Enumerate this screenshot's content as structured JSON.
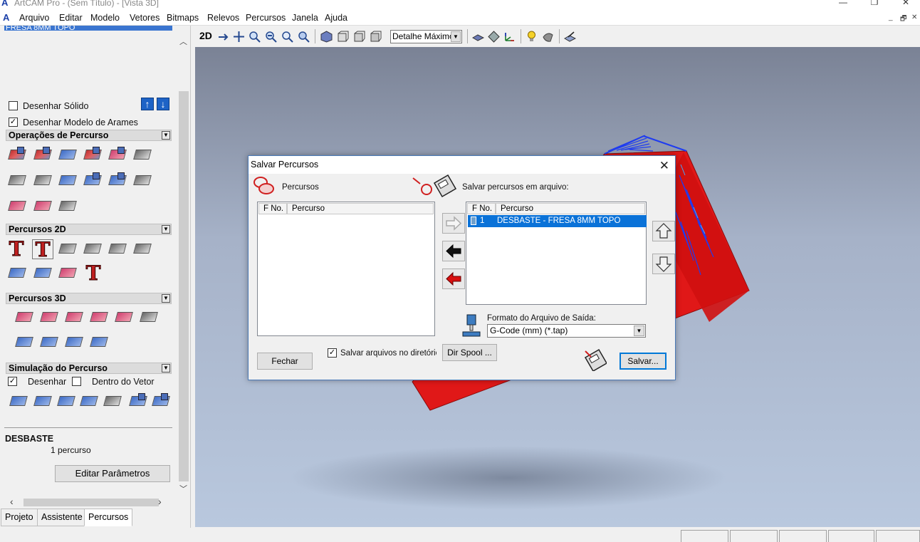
{
  "window": {
    "title": "ArtCAM Pro - (Sem Título) - [Vista 3D]",
    "minimize": "—",
    "maximize": "❐",
    "close": "✕"
  },
  "menu": {
    "items": [
      "Arquivo",
      "Editar",
      "Modelo",
      "Vetores",
      "Bitmaps",
      "Relevos",
      "Percursos",
      "Janela",
      "Ajuda"
    ],
    "mdi_min": "_",
    "mdi_restore": "🗗",
    "mdi_close": "✕"
  },
  "left_panel": {
    "selected_toolpath": "FRESA 8MM TOPO",
    "draw_solid": {
      "label": "Desenhar Sólido",
      "checked": false
    },
    "draw_wireframe": {
      "label": "Desenhar Modelo de Arames",
      "checked": true
    },
    "sections": {
      "operacoes": "Operações de Percurso",
      "percursos2d": "Percursos 2D",
      "percursos3d": "Percursos 3D",
      "simulacao": "Simulação do Percurso"
    },
    "sim_draw": {
      "label": "Desenhar",
      "checked": true
    },
    "sim_inside": {
      "label": "Dentro do Vetor",
      "checked": false
    },
    "toolpath_name": "DESBASTE",
    "toolpath_count": "1 percurso",
    "edit_button": "Editar Parâmetros",
    "tabs": [
      "Projeto",
      "Assistente",
      "Percursos"
    ],
    "active_tab": "Percursos"
  },
  "toolbar": {
    "view_2d": "2D",
    "detail_select": "Detalhe Máximo"
  },
  "dialog": {
    "title": "Salvar Percursos",
    "left_label": "Percursos",
    "right_label": "Salvar percursos em arquivo:",
    "col_fno": "F No.",
    "col_percurso": "Percurso",
    "saved_rows": [
      {
        "fno": "1",
        "name": "DESBASTE - FRESA 8MM TOPO"
      }
    ],
    "format_label": "Formato do Arquivo de Saída:",
    "format_value": "G-Code (mm) (*.tap)",
    "save_in_dir_label": "Salvar arquivos no diretório d",
    "save_in_dir_checked": true,
    "close_button": "Fechar",
    "spool_button": "Dir Spool ...",
    "save_button": "Salvar..."
  },
  "colors": {
    "accent": "#0a72d8",
    "model_red": "#e01818",
    "model_blue": "#1f3cf0"
  }
}
